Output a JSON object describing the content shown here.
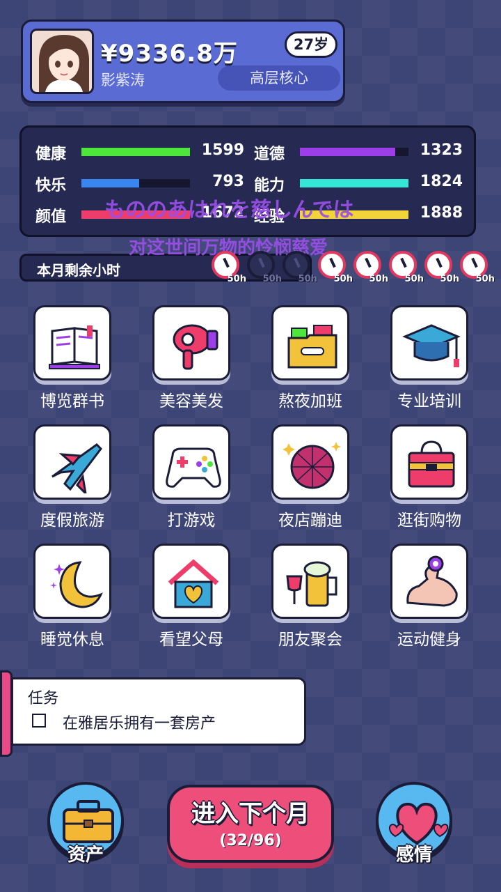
{
  "profile": {
    "money": "¥9336.8万",
    "name": "影紫涛",
    "age": "27岁",
    "rank": "高层核心"
  },
  "stats": [
    {
      "label": "健康",
      "value": "1599",
      "fill": 1.0,
      "color": "#4fe63b"
    },
    {
      "label": "道德",
      "value": "1323",
      "fill": 0.88,
      "color": "#9d3fe8"
    },
    {
      "label": "快乐",
      "value": "793",
      "fill": 0.53,
      "color": "#3a86f0"
    },
    {
      "label": "能力",
      "value": "1824",
      "fill": 1.0,
      "color": "#34e6d6"
    },
    {
      "label": "颜值",
      "value": "1672",
      "fill": 1.0,
      "color": "#ee3d6a"
    },
    {
      "label": "经验",
      "value": "1888",
      "fill": 1.0,
      "color": "#f2d43a"
    }
  ],
  "overlay": {
    "line1": "もののあはれを慈しんでは",
    "line2": "对这世间万物的怜悯慈爱"
  },
  "hours": {
    "label": "本月剩余小时",
    "clocks": [
      {
        "hours": "50h",
        "used": false
      },
      {
        "hours": "50h",
        "used": true
      },
      {
        "hours": "50h",
        "used": true
      },
      {
        "hours": "50h",
        "used": false
      },
      {
        "hours": "50h",
        "used": false
      },
      {
        "hours": "50h",
        "used": false
      },
      {
        "hours": "50h",
        "used": false
      },
      {
        "hours": "50h",
        "used": false
      }
    ]
  },
  "activities": [
    {
      "label": "博览群书",
      "icon": "book-icon"
    },
    {
      "label": "美容美发",
      "icon": "hair-dryer-icon"
    },
    {
      "label": "熬夜加班",
      "icon": "folder-icon"
    },
    {
      "label": "专业培训",
      "icon": "graduation-cap-icon"
    },
    {
      "label": "度假旅游",
      "icon": "airplane-icon"
    },
    {
      "label": "打游戏",
      "icon": "gamepad-icon"
    },
    {
      "label": "夜店蹦迪",
      "icon": "disco-ball-icon"
    },
    {
      "label": "逛街购物",
      "icon": "shopping-bag-icon"
    },
    {
      "label": "睡觉休息",
      "icon": "moon-icon"
    },
    {
      "label": "看望父母",
      "icon": "home-heart-icon"
    },
    {
      "label": "朋友聚会",
      "icon": "beer-icon"
    },
    {
      "label": "运动健身",
      "icon": "muscle-icon"
    }
  ],
  "task": {
    "title": "任务",
    "item": "在雅居乐拥有一套房产"
  },
  "buttons": {
    "assets": "资产",
    "next_title": "进入下个月",
    "next_progress": "(32/96)",
    "emotion": "感情"
  }
}
